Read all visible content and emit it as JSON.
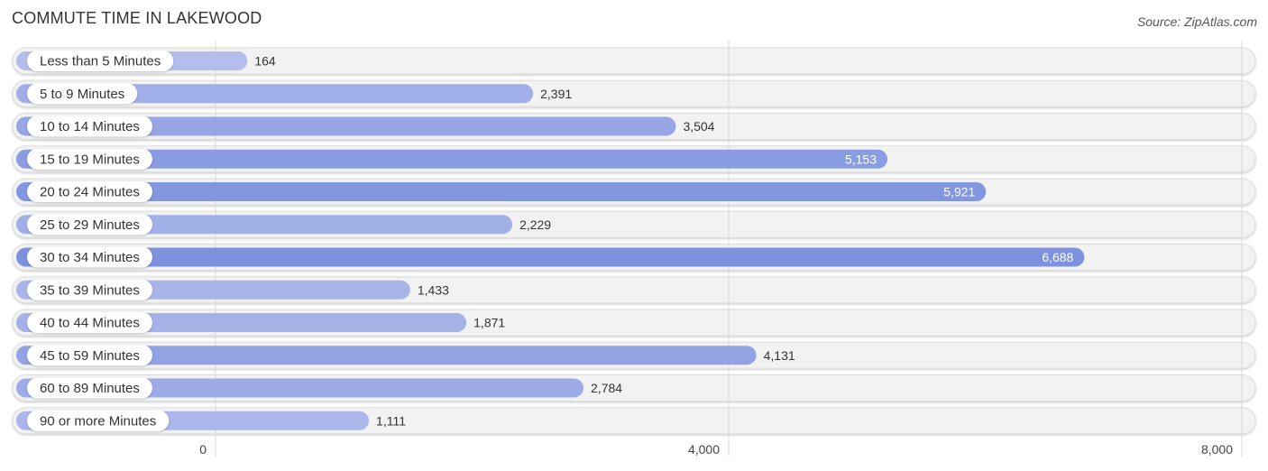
{
  "chart_data": {
    "type": "bar",
    "orientation": "horizontal",
    "title": "COMMUTE TIME IN LAKEWOOD",
    "source": "Source: ZipAtlas.com",
    "categories": [
      "Less than 5 Minutes",
      "5 to 9 Minutes",
      "10 to 14 Minutes",
      "15 to 19 Minutes",
      "20 to 24 Minutes",
      "25 to 29 Minutes",
      "30 to 34 Minutes",
      "35 to 39 Minutes",
      "40 to 44 Minutes",
      "45 to 59 Minutes",
      "60 to 89 Minutes",
      "90 or more Minutes"
    ],
    "values": [
      164,
      2391,
      3504,
      5153,
      5921,
      2229,
      6688,
      1433,
      1871,
      4131,
      2784,
      1111
    ],
    "value_labels": [
      "164",
      "2,391",
      "3,504",
      "5,153",
      "5,921",
      "2,229",
      "6,688",
      "1,433",
      "1,871",
      "4,131",
      "2,784",
      "1,111"
    ],
    "xlim": [
      0,
      8000
    ],
    "xticks": [
      0,
      4000,
      8000
    ],
    "xtick_labels": [
      "0",
      "4,000",
      "8,000"
    ],
    "xlabel": "",
    "ylabel": "",
    "grid": true,
    "legend": "none",
    "colors": {
      "bar_light": "#b4bfec",
      "bar_dark": "#7d91df",
      "track": "#f2f2f2",
      "value_inside": "#ffffff",
      "value_outside": "#333333"
    }
  }
}
